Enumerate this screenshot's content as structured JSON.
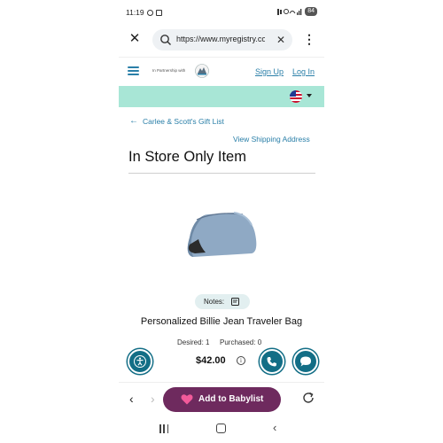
{
  "status_bar": {
    "time": "11:19",
    "battery": "84"
  },
  "browser": {
    "url": "https://www.myregistry.com",
    "close_icon": "close-icon",
    "clear_icon": "clear-icon",
    "menu_icon": "kebab-menu-icon"
  },
  "site_header": {
    "partnership_text": "In Partnership with",
    "sign_up": "Sign Up",
    "log_in": "Log In"
  },
  "page": {
    "breadcrumb": "Carlee & Scott's Gift List",
    "shipping_link": "View Shipping Address",
    "title": "In Store Only Item"
  },
  "product": {
    "notes_label": "Notes:",
    "name": "Personalized Billie Jean Traveler Bag",
    "desired": "Desired: 1",
    "purchased": "Purchased: 0",
    "price": "$42.00"
  },
  "bottom_bar": {
    "add_button": "Add to Babylist"
  },
  "colors": {
    "accent_teal": "#2a7fa8",
    "mint_bar": "#a8e6d6",
    "round_button": "#136e86",
    "add_button": "#6e2a5e",
    "heart": "#f25a9a"
  }
}
